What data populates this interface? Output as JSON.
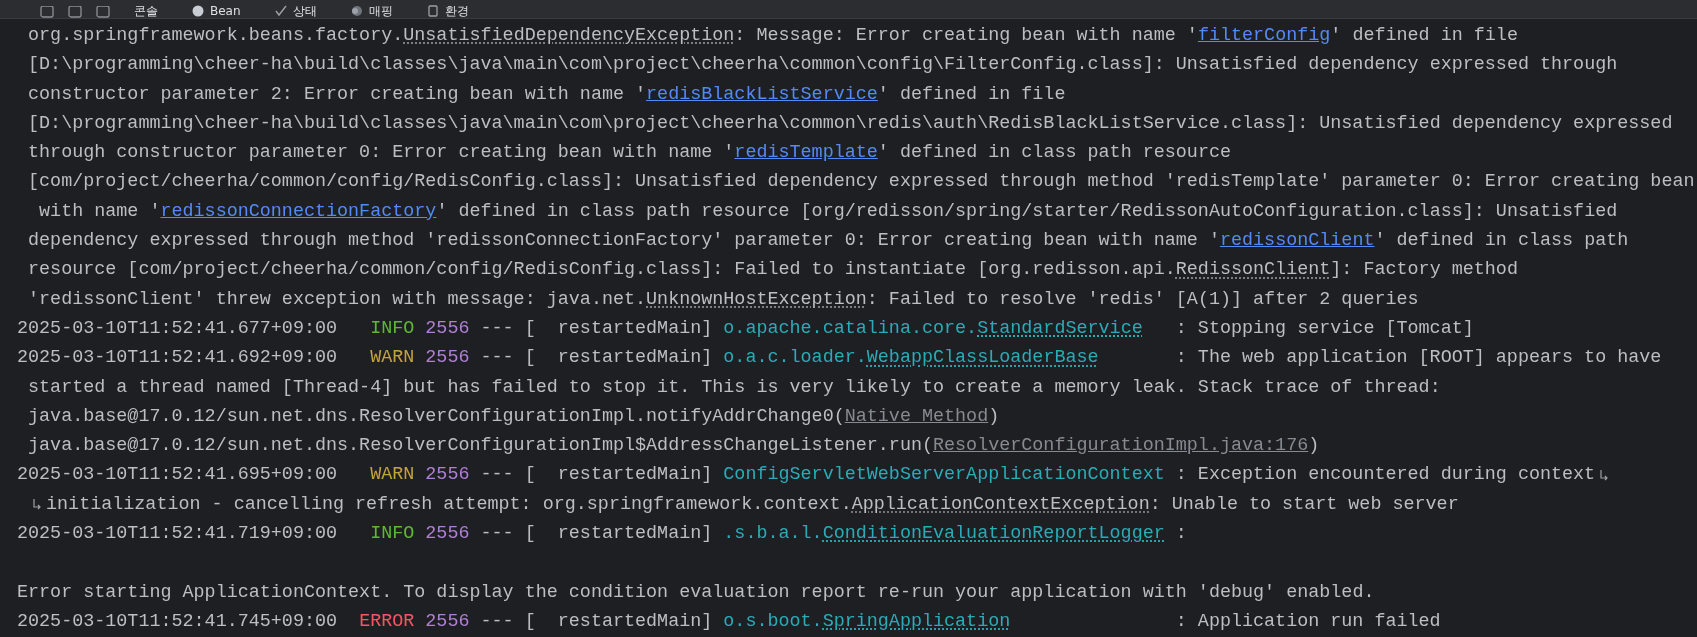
{
  "toolbar": {
    "tabs": [
      {
        "kind": "console",
        "label": "콘솔"
      },
      {
        "kind": "beans",
        "label": "Bean"
      },
      {
        "kind": "health",
        "label": "상태"
      },
      {
        "kind": "mappings",
        "label": "매핑"
      },
      {
        "kind": "environment",
        "label": "환경"
      }
    ]
  },
  "console": {
    "lines": [
      {
        "kind": "wrap",
        "segments": [
          {
            "kind": "text",
            "text": "org.springframework.beans.factory."
          },
          {
            "kind": "class",
            "text": "UnsatisfiedDependencyException"
          },
          {
            "kind": "text",
            "text": ": Message: Error creating bean with name '"
          },
          {
            "kind": "link",
            "text": "filterConfig"
          },
          {
            "kind": "text",
            "text": "' defined in file"
          }
        ]
      },
      {
        "kind": "wrap",
        "segments": [
          {
            "kind": "text",
            "text": "[D:\\programming\\cheer-ha\\build\\classes\\java\\main\\com\\project\\cheerha\\common\\config\\FilterConfig.class]: Unsatisfied dependency expressed through"
          }
        ]
      },
      {
        "kind": "wrap",
        "segments": [
          {
            "kind": "text",
            "text": "constructor parameter 2: Error creating bean with name '"
          },
          {
            "kind": "link",
            "text": "redisBlackListService"
          },
          {
            "kind": "text",
            "text": "' defined in file"
          }
        ]
      },
      {
        "kind": "wrap",
        "segments": [
          {
            "kind": "text",
            "text": "[D:\\programming\\cheer-ha\\build\\classes\\java\\main\\com\\project\\cheerha\\common\\redis\\auth\\RedisBlackListService.class]: Unsatisfied dependency expressed"
          }
        ]
      },
      {
        "kind": "wrap",
        "segments": [
          {
            "kind": "text",
            "text": "through constructor parameter 0: Error creating bean with name '"
          },
          {
            "kind": "link",
            "text": "redisTemplate"
          },
          {
            "kind": "text",
            "text": "' defined in class path resource"
          }
        ]
      },
      {
        "kind": "wrap",
        "segments": [
          {
            "kind": "text",
            "text": "[com/project/cheerha/common/config/RedisConfig.class]: Unsatisfied dependency expressed through method 'redisTemplate' parameter 0: Error creating bean"
          }
        ]
      },
      {
        "kind": "wrap",
        "segments": [
          {
            "kind": "text",
            "text": " with name '"
          },
          {
            "kind": "link",
            "text": "redissonConnectionFactory"
          },
          {
            "kind": "text",
            "text": "' defined in class path resource [org/redisson/spring/starter/RedissonAutoConfiguration.class]: Unsatisfied"
          }
        ]
      },
      {
        "kind": "wrap",
        "segments": [
          {
            "kind": "text",
            "text": "dependency expressed through method 'redissonConnectionFactory' parameter 0: Error creating bean with name '"
          },
          {
            "kind": "link",
            "text": "redissonClient"
          },
          {
            "kind": "text",
            "text": "' defined in class path"
          }
        ]
      },
      {
        "kind": "wrap",
        "segments": [
          {
            "kind": "text",
            "text": "resource [com/project/cheerha/common/config/RedisConfig.class]: Failed to instantiate [org.redisson.api."
          },
          {
            "kind": "class",
            "text": "RedissonClient"
          },
          {
            "kind": "text",
            "text": "]: Factory method"
          }
        ]
      },
      {
        "kind": "wrap",
        "segments": [
          {
            "kind": "text",
            "text": "'redissonClient' threw exception with message: java.net."
          },
          {
            "kind": "class",
            "text": "UnknownHostException"
          },
          {
            "kind": "text",
            "text": ": Failed to resolve 'redis' [A(1)] after 2 queries"
          }
        ]
      },
      {
        "kind": "log",
        "timestamp": "2025-03-10T11:52:41.677+09:00",
        "level": "INFO",
        "color": "#5fb832",
        "pid": "2556",
        "thread": "--- [  restartedMain]",
        "logger": {
          "package": "o.apache.catalina.core.",
          "class": "StandardService"
        },
        "segments": [
          {
            "kind": "text",
            "text": ": Stopping service [Tomcat]"
          }
        ]
      },
      {
        "kind": "log",
        "timestamp": "2025-03-10T11:52:41.692+09:00",
        "level": "WARN",
        "color": "#c2a43a",
        "pid": "2556",
        "thread": "--- [  restartedMain]",
        "logger": {
          "package": "o.a.c.loader.",
          "class": "WebappClassLoaderBase"
        },
        "segments": [
          {
            "kind": "text",
            "text": ": The web application [ROOT] appears to have"
          }
        ]
      },
      {
        "kind": "wrap",
        "segments": [
          {
            "kind": "text",
            "text": "started a thread named [Thread-4] but has failed to stop it. This is very likely to create a memory leak. Stack trace of thread:"
          }
        ]
      },
      {
        "kind": "wrap",
        "segments": [
          {
            "kind": "text",
            "text": "java.base@17.0.12/sun.net.dns.ResolverConfigurationImpl.notifyAddrChange0("
          },
          {
            "kind": "source",
            "text": "Native Method"
          },
          {
            "kind": "text",
            "text": ")"
          }
        ]
      },
      {
        "kind": "wrap",
        "segments": [
          {
            "kind": "text",
            "text": "java.base@17.0.12/sun.net.dns.ResolverConfigurationImpl$AddressChangeListener.run("
          },
          {
            "kind": "source",
            "text": "ResolverConfigurationImpl.java:176"
          },
          {
            "kind": "text",
            "text": ")"
          }
        ]
      },
      {
        "kind": "log",
        "timestamp": "2025-03-10T11:52:41.695+09:00",
        "level": "WARN",
        "color": "#c2a43a",
        "pid": "2556",
        "thread": "--- [  restartedMain]",
        "logger": {
          "name": "ConfigServletWebServerApplicationContext"
        },
        "segments": [
          {
            "kind": "text",
            "text": ": Exception encountered during context"
          },
          {
            "kind": "wrap-mark"
          }
        ]
      },
      {
        "kind": "wrap",
        "segments": [
          {
            "kind": "wrap-mark"
          },
          {
            "kind": "text",
            "text": "initialization - cancelling refresh attempt: org.springframework.context."
          },
          {
            "kind": "class",
            "text": "ApplicationContextException"
          },
          {
            "kind": "text",
            "text": ": Unable to start web server"
          }
        ]
      },
      {
        "kind": "log",
        "timestamp": "2025-03-10T11:52:41.719+09:00",
        "level": "INFO",
        "color": "#5fb832",
        "pid": "2556",
        "thread": "--- [  restartedMain]",
        "logger": {
          "package": ".s.b.a.l.",
          "class": "ConditionEvaluationReportLogger"
        },
        "segments": [
          {
            "kind": "text",
            "text": ":"
          }
        ]
      },
      {
        "kind": "blank"
      },
      {
        "kind": "plain",
        "segments": [
          {
            "kind": "text",
            "text": "Error starting ApplicationContext. To display the condition evaluation report re-run your application with 'debug' enabled."
          }
        ]
      },
      {
        "kind": "log",
        "timestamp": "2025-03-10T11:52:41.745+09:00",
        "level": "ERROR",
        "color": "#f75464",
        "pid": "2556",
        "thread": "--- [  restartedMain]",
        "logger": {
          "package": "o.s.boot.",
          "class": "SpringApplication"
        },
        "segments": [
          {
            "kind": "text",
            "text": ": Application run failed"
          }
        ]
      }
    ]
  }
}
